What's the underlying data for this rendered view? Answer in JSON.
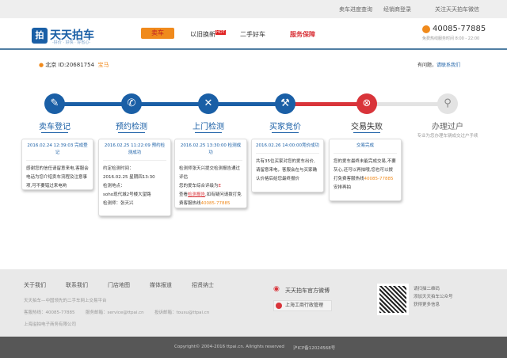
{
  "topbar": {
    "links": [
      "卖车进度查询",
      "经销商登录",
      "关注天天拍车微信"
    ]
  },
  "header": {
    "logo_mark": "拍",
    "logo_text": "天天拍车",
    "logo_slogan": "-好价 · 好快 · 好省心-",
    "nav": [
      "卖车",
      "以旧换新",
      "二手好车",
      "服务保障"
    ],
    "nav_badge": "HOT",
    "phone": "40085-77885",
    "phone_hours": "免费热线服务时间 8:00 - 22:00"
  },
  "sub": {
    "location": "北京",
    "id": "ID:20681754",
    "car": "宝马",
    "help": "有问题，",
    "contact": "请联系我们"
  },
  "steps": [
    {
      "label": "卖车登记",
      "icon": "form-icon"
    },
    {
      "label": "预约检测",
      "icon": "phone-icon"
    },
    {
      "label": "上门检测",
      "icon": "tools-icon"
    },
    {
      "label": "买家竞价",
      "icon": "gavel-icon"
    },
    {
      "label": "交易失败",
      "icon": "fail-icon"
    },
    {
      "label": "办理过户",
      "icon": "stamp-icon",
      "desc": "专业为您办理车辆成交过户手续"
    }
  ],
  "cards": [
    {
      "head": "2016.02.24 12:39:03 完成登记",
      "lines": [
        "感谢您的信任请留意来电,客服会电话为您介绍卖车流程及注意事项,可不要错过来电哟"
      ]
    },
    {
      "head": "2016.02.25 11:22:09 预约检测成功",
      "lines": [
        "约定检测时间：",
        "2016.02.25 星期四13:30",
        "检测地点：",
        "soho现代城2号楼大望路",
        "检测师：张天兴"
      ]
    },
    {
      "head": "2016.02.25 13:30:00 检测成功",
      "l1": "检测师张天兴提交检测报告通过评估",
      "l2a": "您的爱车综合评级为",
      "grade": "E",
      "l3a": "查看",
      "report": "检测报告",
      "l3b": ",如有疑问请拨打免费客服热线",
      "phone": "40085-77885"
    },
    {
      "head": "2016.02.26 14:00:00竞价成功",
      "lines": [
        "共有35位买家对您的爱车出价,请留意来电，客服会在与买家确认价格后给您最终报价"
      ]
    },
    {
      "head": "交易完成",
      "l1": "您的爱车最终未能完成交易,不要灰心,还可以再拍哦,您也可以拨打免费客服热线",
      "phone": "40085-77885",
      "l2": "安排再拍"
    }
  ],
  "footer": {
    "links": [
      "关于我们",
      "联系我们",
      "门店地图",
      "媒体报道",
      "招贤纳士"
    ],
    "tagline": "天天拍车—中国领先的二手车网上交易平台",
    "hotline": "客服热线：40085-77885",
    "service": "服务邮箱：service@ttpai.cn",
    "complaint": "投诉邮箱：tousu@ttpai.cn",
    "company": "上海溢拍电子商务有限公司",
    "weibo": "天天拍车官方微博",
    "gov": "上海工商行政管理",
    "qr": [
      "请扫描二维码",
      "添加天天拍车公众号",
      "获得更多信息"
    ],
    "copyright": "Copyright© 2004-2016 ttpai.cn. Allrights reserved",
    "icp": "沪ICP备12024568号"
  }
}
